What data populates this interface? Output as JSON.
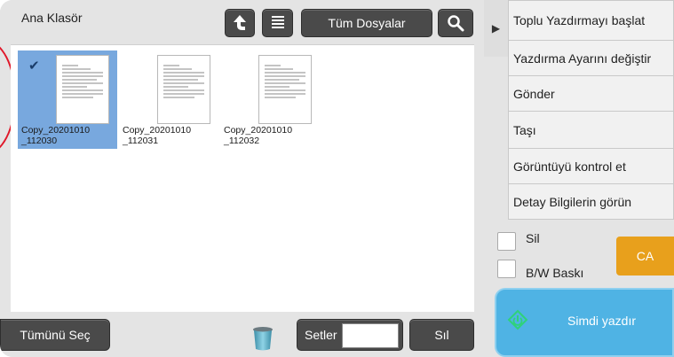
{
  "header": {
    "folder_title": "Ana Klasör",
    "all_files_label": "Tüm Dosyalar"
  },
  "files": [
    {
      "name": "Copy_20201010_112030",
      "line1": "Copy_20201010",
      "line2": "_112030",
      "selected": true
    },
    {
      "name": "Copy_20201010_112031",
      "line1": "Copy_20201010",
      "line2": "_112031",
      "selected": false
    },
    {
      "name": "Copy_20201010_112032",
      "line1": "Copy_20201010",
      "line2": "_112032",
      "selected": false
    }
  ],
  "bottom_bar": {
    "select_all_label": "Tümünü Seç",
    "sets_label": "Setler",
    "sets_value": "",
    "delete_label": "Sıl"
  },
  "menu": {
    "items": [
      {
        "label": "Toplu Yazdırmayı başlat"
      },
      {
        "label": "Yazdırma Ayarını değiştir"
      },
      {
        "label": "Gönder"
      },
      {
        "label": "Taşı"
      },
      {
        "label": "Görüntüyü kontrol et"
      },
      {
        "label": "Detay Bilgilerin görün"
      }
    ]
  },
  "options": {
    "delete_checkbox_label": "Sil",
    "delete_checked": false,
    "bw_print_label": "B/W Baskı",
    "bw_print_checked": false
  },
  "actions": {
    "ca_label": "CA",
    "print_now_label": "Simdi yazdır"
  },
  "icons": {
    "up": "up-arrow-icon",
    "list": "list-view-icon",
    "search": "search-icon",
    "trash": "trash-icon",
    "print": "start-diamond-icon",
    "collapse": "collapse-arrow-icon"
  },
  "colors": {
    "selected_thumb": "#78a8de",
    "dark_button": "#4a4a4a",
    "ca_button": "#e8a01c",
    "print_button": "#4fb3e4",
    "marker": "#e0182a"
  }
}
